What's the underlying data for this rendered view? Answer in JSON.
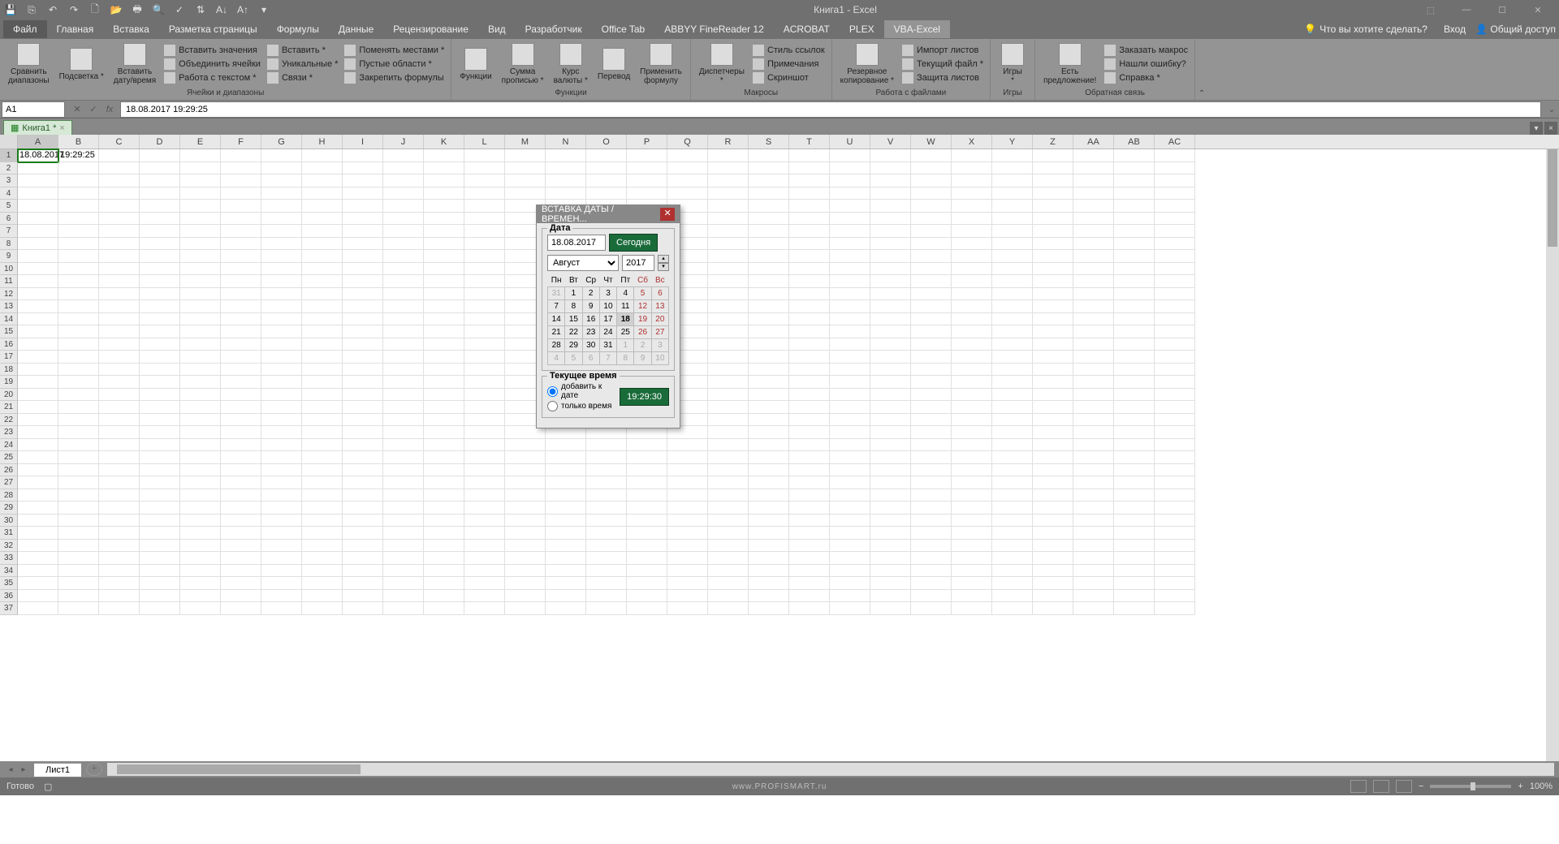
{
  "app": {
    "title": "Книга1 - Excel"
  },
  "qat": [
    "save",
    "save-all",
    "undo",
    "redo",
    "new",
    "open",
    "print",
    "print-preview",
    "spell",
    "sort",
    "sort-asc",
    "sort-desc",
    "more"
  ],
  "tabs": {
    "file": "Файл",
    "items": [
      "Главная",
      "Вставка",
      "Разметка страницы",
      "Формулы",
      "Данные",
      "Рецензирование",
      "Вид",
      "Разработчик",
      "Office Tab",
      "ABBYY FineReader 12",
      "ACROBAT",
      "PLEX",
      "VBA-Excel"
    ],
    "active": "VBA-Excel",
    "tellme": "Что вы хотите сделать?",
    "login": "Вход",
    "share": "Общий доступ"
  },
  "ribbon": {
    "groups": [
      {
        "label": "Ячейки и диапазоны",
        "big": [
          {
            "t": "Сравнить\nдиапазоны"
          },
          {
            "t": "Подсветка *"
          },
          {
            "t": "Вставить\nдату/время"
          }
        ],
        "small": [
          [
            "Вставить значения",
            "Объединить ячейки",
            "Работа с текстом *"
          ],
          [
            "Вставить *",
            "Уникальные *",
            "Связи *"
          ],
          [
            "Поменять местами *",
            "Пустые области *",
            "Закрепить формулы"
          ]
        ]
      },
      {
        "label": "Функции",
        "big": [
          {
            "t": "Функции"
          },
          {
            "t": "Сумма\nпрописью *"
          },
          {
            "t": "Курс\nвалюты *"
          },
          {
            "t": "Перевод"
          },
          {
            "t": "Применить\nформулу"
          }
        ]
      },
      {
        "label": "Макросы",
        "big": [
          {
            "t": "Диспетчеры\n*"
          }
        ],
        "small": [
          [
            "Стиль ссылок",
            "Примечания",
            "Скриншот"
          ]
        ]
      },
      {
        "label": "Работа с файлами",
        "big": [
          {
            "t": "Резервное\nкопирование *"
          }
        ],
        "small": [
          [
            "Импорт листов",
            "Текущий файл *",
            "Защита листов"
          ]
        ]
      },
      {
        "label": "Игры",
        "big": [
          {
            "t": "Игры\n*"
          }
        ]
      },
      {
        "label": "Обратная связь",
        "big": [
          {
            "t": "Есть\nпредложение!"
          }
        ],
        "small": [
          [
            "Заказать макрос",
            "Нашли ошибку?",
            "Справка *"
          ]
        ]
      }
    ]
  },
  "namebox": "A1",
  "formula": "18.08.2017 19:29:25",
  "wbtab": "Книга1 *",
  "columns": [
    "A",
    "B",
    "C",
    "D",
    "E",
    "F",
    "G",
    "H",
    "I",
    "J",
    "K",
    "L",
    "M",
    "N",
    "O",
    "P",
    "Q",
    "R",
    "S",
    "T",
    "U",
    "V",
    "W",
    "X",
    "Y",
    "Z",
    "AA",
    "AB",
    "AC"
  ],
  "selected_col": "A",
  "rows_count": 37,
  "cells": {
    "A1": "18.08.2017",
    "B1": "19:29:25"
  },
  "sheet": "Лист1",
  "status": "Готово",
  "zoom": "100%",
  "watermark": "www.PROFISMART.ru",
  "dialog": {
    "title": "ВСТАВКА ДАТЫ / ВРЕМЕН...",
    "date_label": "Дата",
    "date_value": "18.08.2017",
    "today_btn": "Сегодня",
    "month": "Август",
    "year": "2017",
    "weekdays": [
      "Пн",
      "Вт",
      "Ср",
      "Чт",
      "Пт",
      "Сб",
      "Вс"
    ],
    "calendar": [
      [
        {
          "d": 31,
          "o": true
        },
        {
          "d": 1
        },
        {
          "d": 2
        },
        {
          "d": 3
        },
        {
          "d": 4
        },
        {
          "d": 5,
          "w": true
        },
        {
          "d": 6,
          "w": true
        }
      ],
      [
        {
          "d": 7
        },
        {
          "d": 8
        },
        {
          "d": 9
        },
        {
          "d": 10
        },
        {
          "d": 11
        },
        {
          "d": 12,
          "w": true
        },
        {
          "d": 13,
          "w": true
        }
      ],
      [
        {
          "d": 14
        },
        {
          "d": 15
        },
        {
          "d": 16
        },
        {
          "d": 17
        },
        {
          "d": 18,
          "t": true
        },
        {
          "d": 19,
          "w": true
        },
        {
          "d": 20,
          "w": true
        }
      ],
      [
        {
          "d": 21
        },
        {
          "d": 22
        },
        {
          "d": 23
        },
        {
          "d": 24
        },
        {
          "d": 25
        },
        {
          "d": 26,
          "w": true
        },
        {
          "d": 27,
          "w": true
        }
      ],
      [
        {
          "d": 28
        },
        {
          "d": 29
        },
        {
          "d": 30
        },
        {
          "d": 31
        },
        {
          "d": 1,
          "o": true
        },
        {
          "d": 2,
          "o": true
        },
        {
          "d": 3,
          "o": true
        }
      ],
      [
        {
          "d": 4,
          "o": true
        },
        {
          "d": 5,
          "o": true
        },
        {
          "d": 6,
          "o": true
        },
        {
          "d": 7,
          "o": true
        },
        {
          "d": 8,
          "o": true
        },
        {
          "d": 9,
          "o": true
        },
        {
          "d": 10,
          "o": true
        }
      ]
    ],
    "time_label": "Текущее время",
    "opt_add": "добавить к дате",
    "opt_only": "только время",
    "time_value": "19:29:30"
  }
}
